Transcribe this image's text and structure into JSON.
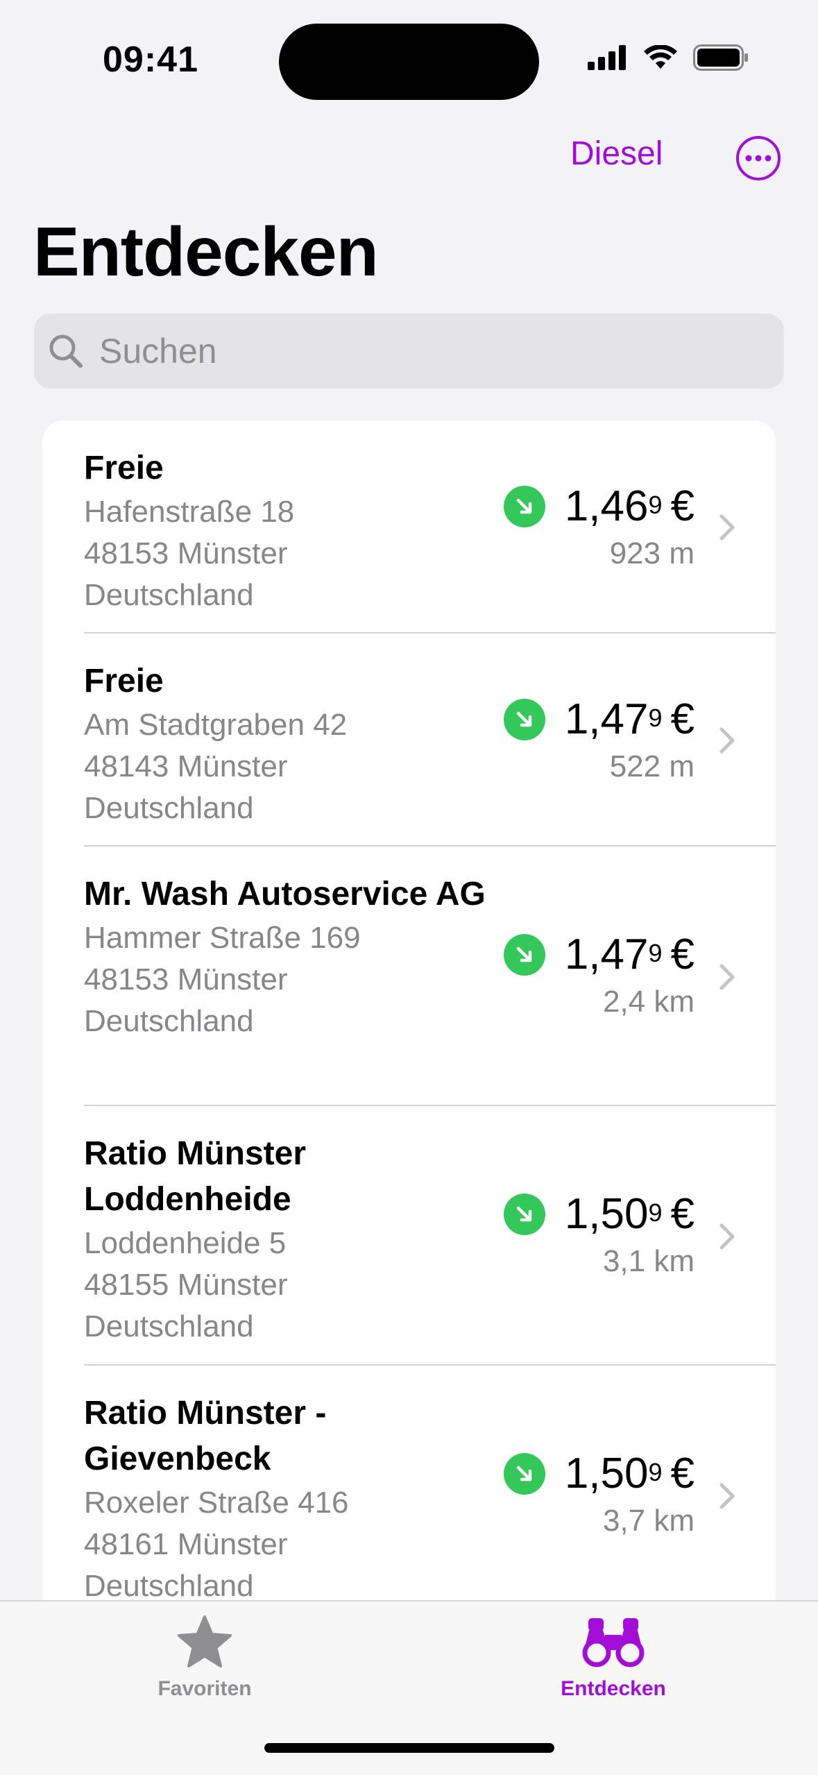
{
  "status_bar": {
    "time": "09:41"
  },
  "nav": {
    "fuel_type": "Diesel",
    "more_icon": "ellipsis-circle-icon",
    "title": "Entdecken"
  },
  "search": {
    "placeholder": "Suchen"
  },
  "stations": [
    {
      "name": "Freie",
      "street": "Hafenstraße 18",
      "city": "48153 Münster",
      "country": "Deutschland",
      "price_main": "1,46",
      "price_sup": "9",
      "currency": "€",
      "distance": "923 m",
      "trend": "down"
    },
    {
      "name": "Freie",
      "street": "Am Stadtgraben 42",
      "city": "48143 Münster",
      "country": "Deutschland",
      "price_main": "1,47",
      "price_sup": "9",
      "currency": "€",
      "distance": "522 m",
      "trend": "down"
    },
    {
      "name": "Mr. Wash Autoservice AG",
      "street": "Hammer Straße 169",
      "city": "48153 Münster",
      "country": "Deutschland",
      "price_main": "1,47",
      "price_sup": "9",
      "currency": "€",
      "distance": "2,4 km",
      "trend": "down"
    },
    {
      "name": "Ratio Münster Loddenheide",
      "street": "Loddenheide 5",
      "city": "48155 Münster",
      "country": "Deutschland",
      "price_main": "1,50",
      "price_sup": "9",
      "currency": "€",
      "distance": "3,1 km",
      "trend": "down"
    },
    {
      "name": "Ratio Münster - Gievenbeck",
      "street": "Roxeler Straße 416",
      "city": "48161 Münster",
      "country": "Deutschland",
      "price_main": "1,50",
      "price_sup": "9",
      "currency": "€",
      "distance": "3,7 km",
      "trend": "down"
    }
  ],
  "tabs": [
    {
      "label": "Favoriten",
      "icon": "star-icon",
      "active": false
    },
    {
      "label": "Entdecken",
      "icon": "binoculars-icon",
      "active": true
    }
  ],
  "colors": {
    "accent": "#A20DD8",
    "trend_down": "#34C759",
    "secondary_text": "#86868B",
    "background": "#F2F2F7"
  }
}
